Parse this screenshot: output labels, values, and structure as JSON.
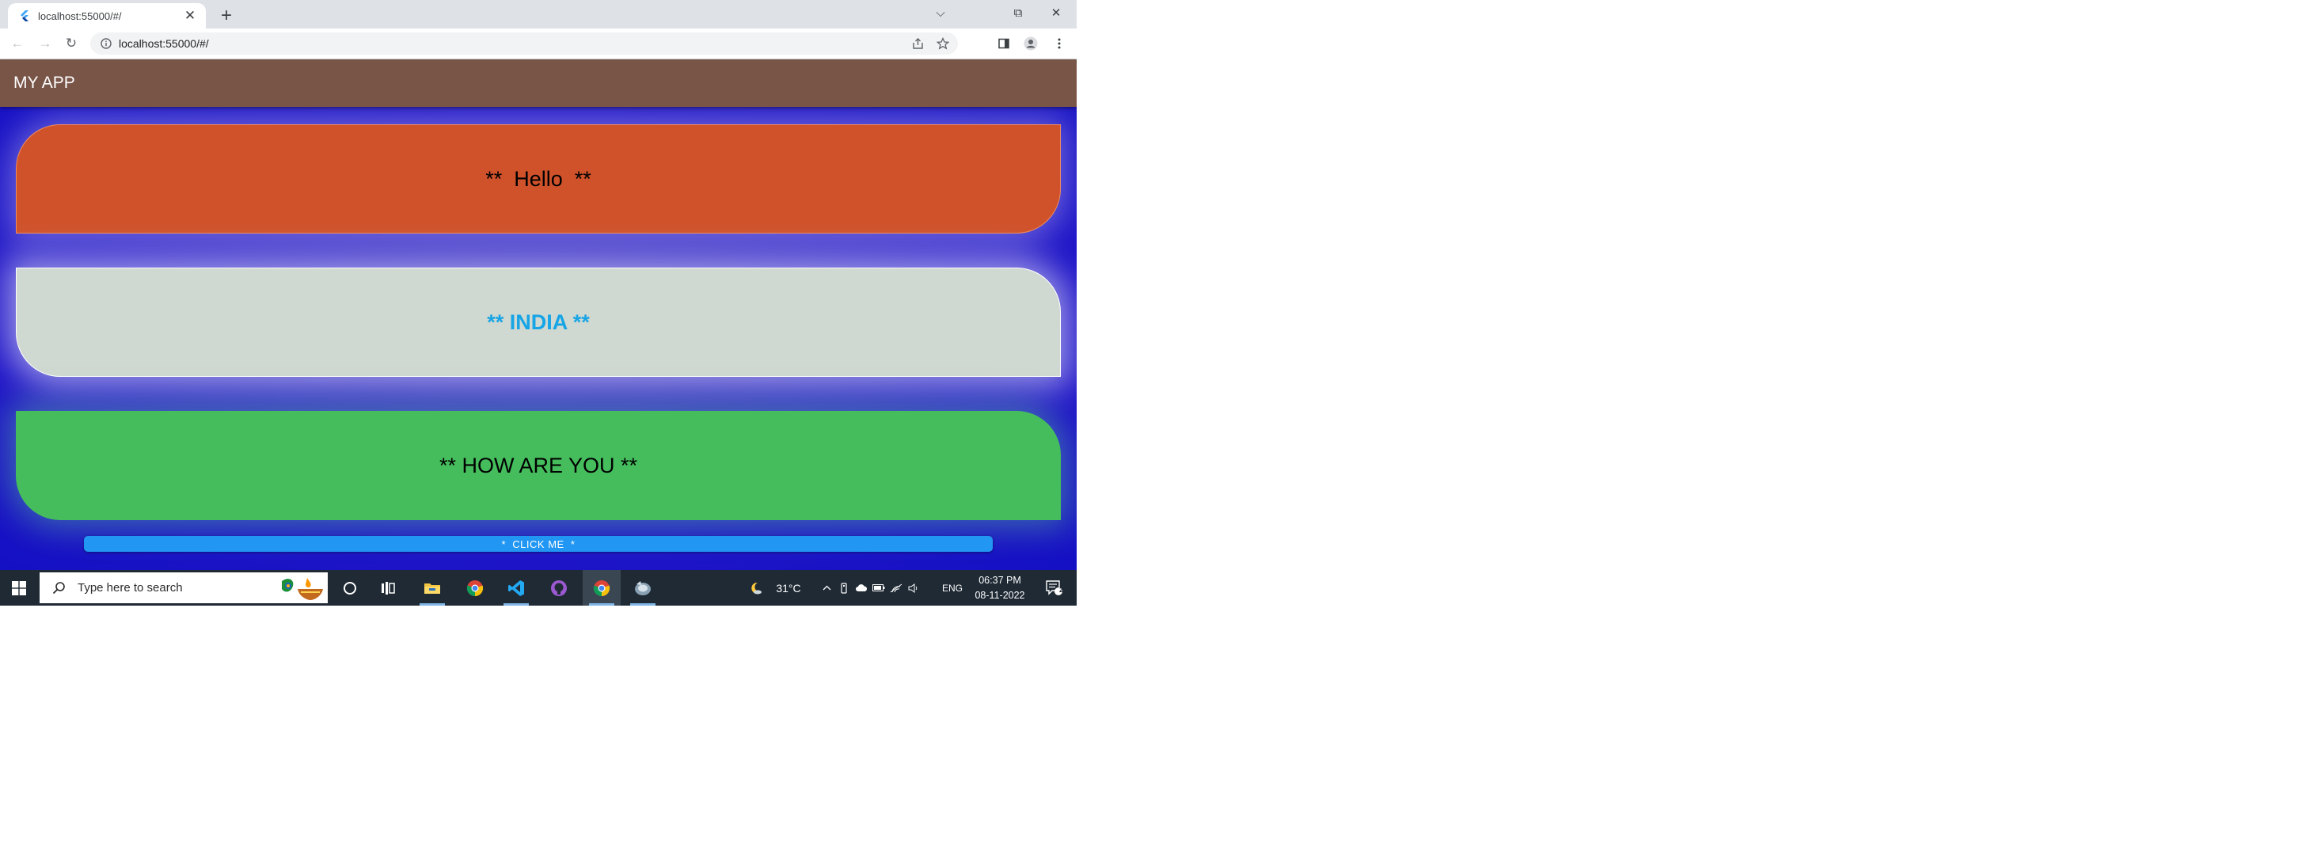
{
  "browser": {
    "tab_title": "localhost:55000/#/",
    "tab_close_glyph": "✕",
    "new_tab_glyph": "+",
    "url": "localhost:55000/#/",
    "window_controls": {
      "minimize_glyph": "⌵",
      "restore_glyph": "⧉",
      "close_glyph": "✕"
    },
    "nav": {
      "back_glyph": "←",
      "forward_glyph": "→",
      "reload_glyph": "↻"
    },
    "toolbar_icons": [
      "share-icon",
      "star-icon",
      "side-panel-icon",
      "profile-icon",
      "menu-kebab-icon"
    ]
  },
  "app": {
    "title": "MY APP",
    "cards": [
      {
        "label": "**  Hello  **"
      },
      {
        "label": "** INDIA **"
      },
      {
        "label": "** HOW ARE YOU **"
      }
    ],
    "button_label": "*  CLICK ME  *",
    "colors": {
      "appbar": "#795548",
      "background": "#2418c9",
      "card_hello": "#cf522b",
      "card_india": "#cfd8d1",
      "card_india_text": "#16a5e6",
      "card_how": "#45bd5d",
      "button": "#2196f3"
    }
  },
  "taskbar": {
    "search_placeholder": "Type here to search",
    "search_highlight_icon": "diya-lamp-icon",
    "apps": [
      "cortana-icon",
      "task-view-icon",
      "file-explorer-icon",
      "chrome-icon",
      "vscode-icon",
      "github-icon",
      "chrome-icon",
      "app-icon"
    ],
    "weather_temp": "31°C",
    "language": "ENG",
    "time": "06:37 PM",
    "date": "08-11-2022",
    "notification_count": "2"
  }
}
